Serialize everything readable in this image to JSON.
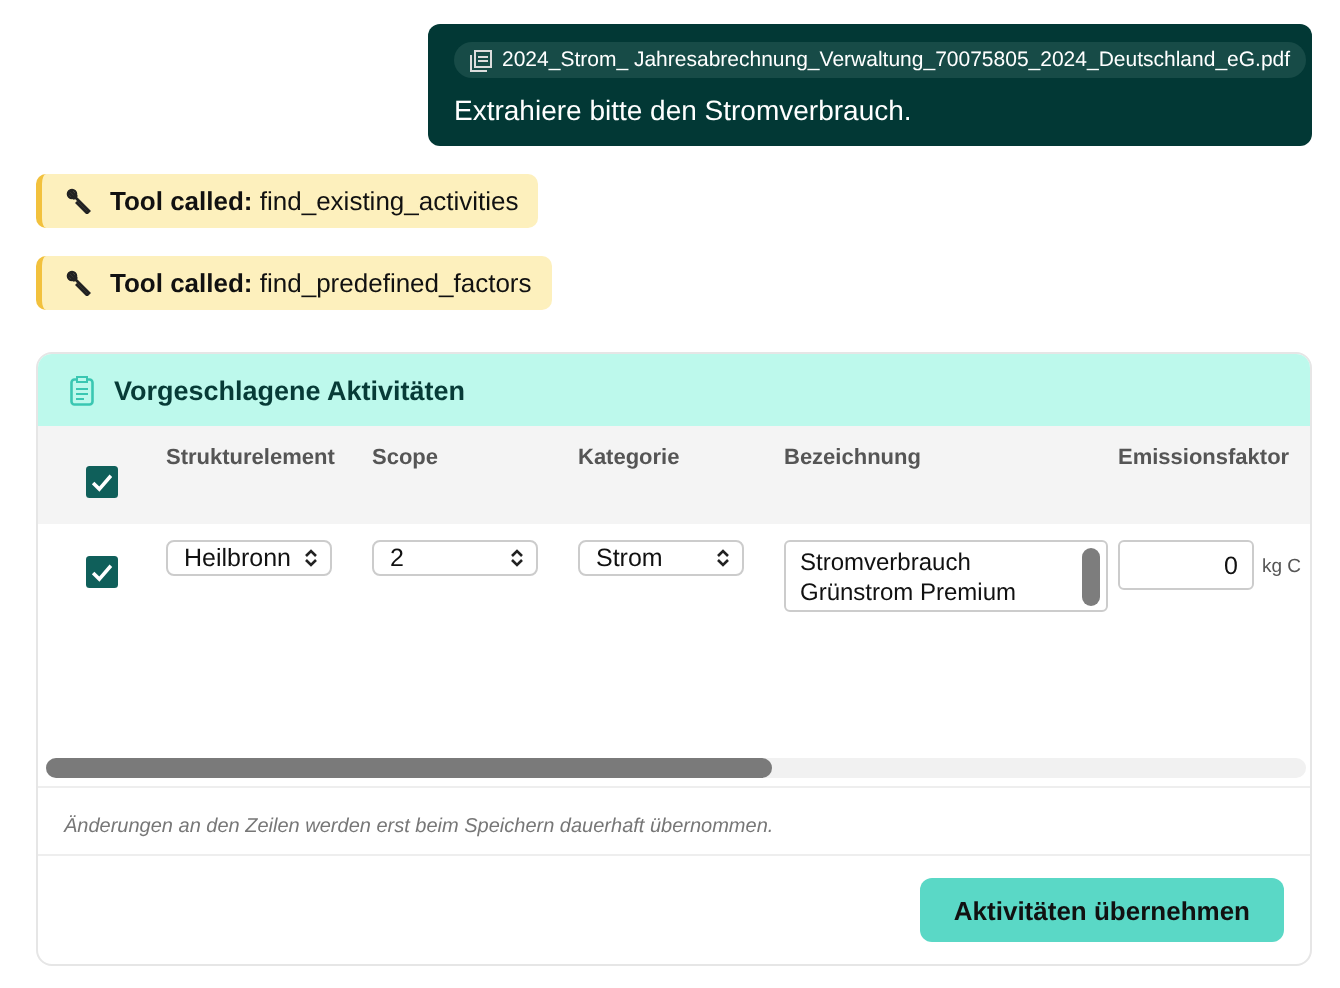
{
  "message": {
    "attachment": "2024_Strom_ Jahresabrechnung_Verwaltung_70075805_2024_Deutschland_eG.pdf",
    "text": "Extrahiere bitte den Stromverbrauch."
  },
  "tool_calls": [
    {
      "label": "Tool called:",
      "name": "find_existing_activities"
    },
    {
      "label": "Tool called:",
      "name": "find_predefined_factors"
    }
  ],
  "card": {
    "title": "Vorgeschlagene Aktivitäten",
    "select_all": {
      "checked": true
    },
    "columns": [
      "Strukturelement",
      "Scope",
      "Kategorie",
      "Bezeichnung",
      "Emissionsfaktor"
    ],
    "rows": [
      {
        "checked": true,
        "strukturelement": "Heilbronn",
        "scope": "2",
        "kategorie": "Strom",
        "bezeichnung": "Stromverbrauch Grünstrom Premium",
        "emissionsfaktor": "0",
        "unit": "kg C"
      }
    ],
    "note": "Änderungen an den Zeilen werden erst beim Speichern dauerhaft übernommen.",
    "button": "Aktivitäten übernehmen"
  }
}
